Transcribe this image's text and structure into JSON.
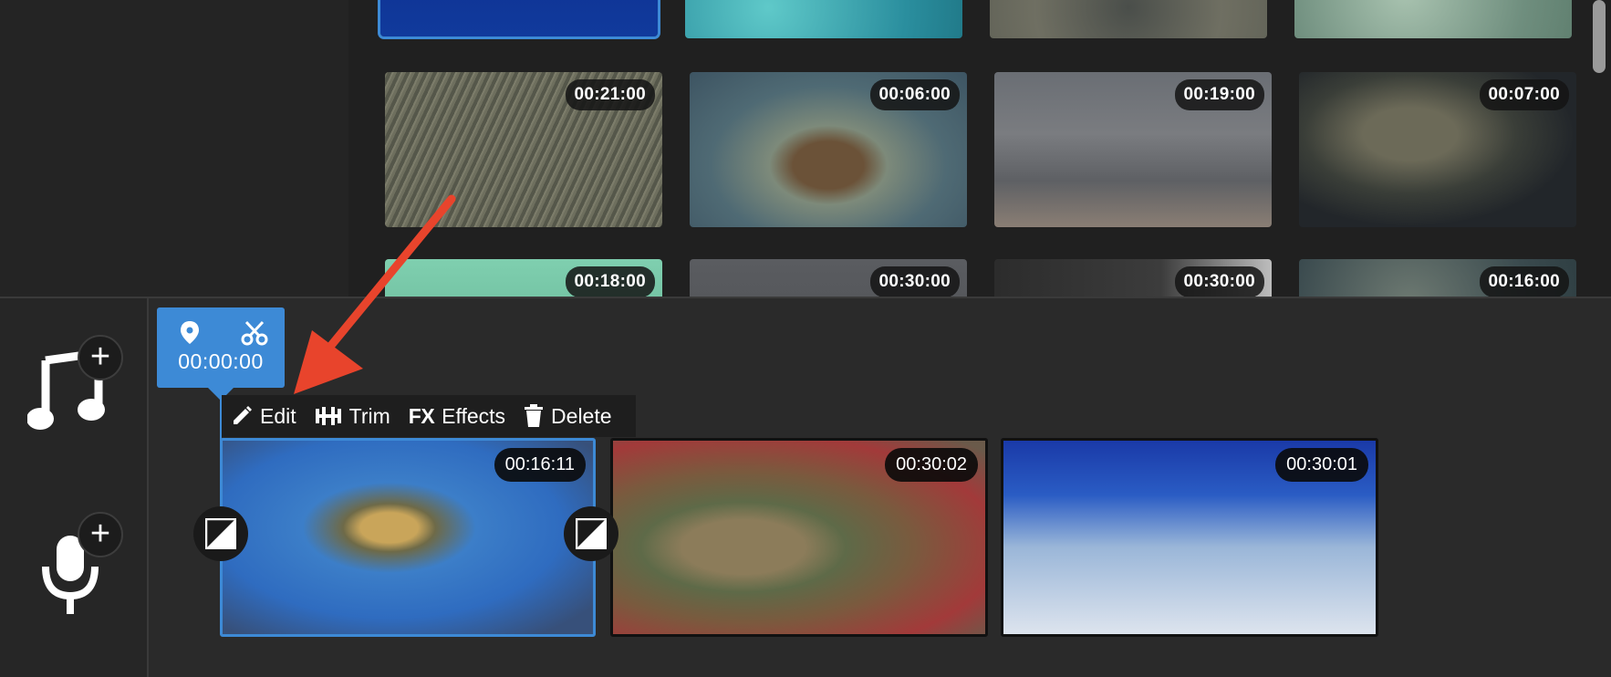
{
  "library": {
    "row1": [
      {
        "duration": "",
        "tone": "blue-deep"
      },
      {
        "duration": "",
        "tone": "aqua"
      },
      {
        "duration": "",
        "tone": "rock"
      },
      {
        "duration": "",
        "tone": "seaglass"
      }
    ],
    "row2": [
      {
        "duration": "00:21:00",
        "tone": "seagrass"
      },
      {
        "duration": "00:06:00",
        "tone": "reef-turtle"
      },
      {
        "duration": "00:19:00",
        "tone": "dusk-beach"
      },
      {
        "duration": "00:07:00",
        "tone": "hand-turtle"
      }
    ],
    "row3": [
      {
        "duration": "00:18:00",
        "tone": "mint"
      },
      {
        "duration": "00:30:00",
        "tone": "grey"
      },
      {
        "duration": "00:30:00",
        "tone": "dark-rock"
      },
      {
        "duration": "00:16:00",
        "tone": "reef-dark"
      }
    ]
  },
  "tracks": {
    "music_icon": "music-note-icon",
    "voice_icon": "microphone-icon",
    "add_symbol": "+"
  },
  "playhead": {
    "time": "00:00:00",
    "marker_icon": "location-pin-icon",
    "split_icon": "scissors-icon"
  },
  "clip_toolbar": {
    "edit": "Edit",
    "trim": "Trim",
    "fx": "FX",
    "effects": "Effects",
    "delete": "Delete"
  },
  "timeline_clips": [
    {
      "duration": "00:16:11",
      "selected": true
    },
    {
      "duration": "00:30:02",
      "selected": false
    },
    {
      "duration": "00:30:01",
      "selected": false
    }
  ],
  "colors": {
    "accent": "#3d8ad6",
    "annotation_arrow": "#e8442c",
    "background": "#2b2b2b"
  }
}
